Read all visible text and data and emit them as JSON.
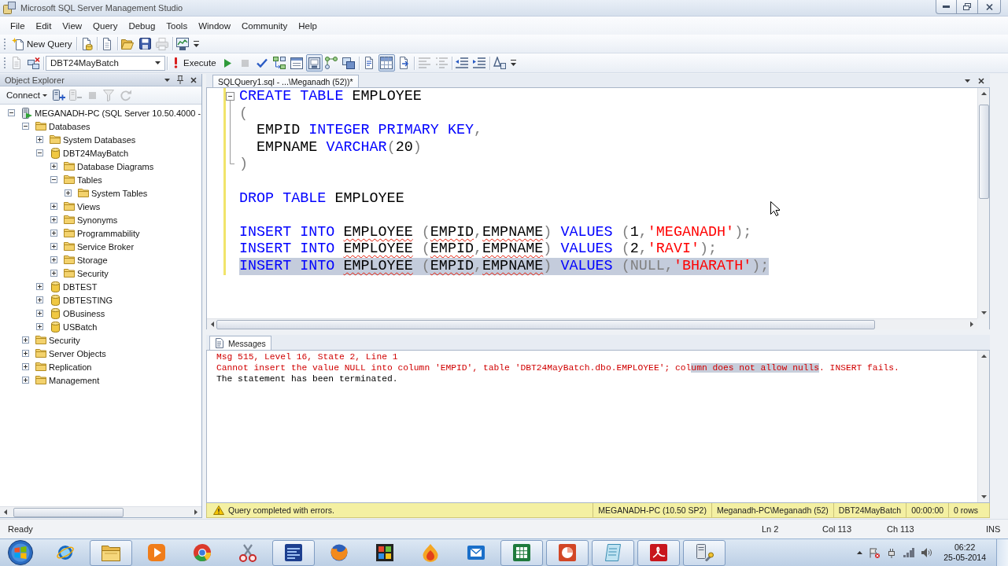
{
  "window": {
    "title": "Microsoft SQL Server Management Studio"
  },
  "menu": [
    "File",
    "Edit",
    "View",
    "Query",
    "Debug",
    "Tools",
    "Window",
    "Community",
    "Help"
  ],
  "standard_toolbar": {
    "new_query": "New Query",
    "button_groups": [
      [
        {
          "disabled": false
        }
      ],
      [
        {
          "disabled": false
        }
      ],
      [
        {
          "disabled": false
        },
        {
          "disabled": false
        },
        {
          "disabled": true
        }
      ],
      [
        {
          "disabled": false
        }
      ]
    ]
  },
  "query_toolbar": {
    "leading": [
      {
        "disabled": true
      },
      {
        "disabled": false
      }
    ],
    "database": "DBT24MayBatch",
    "execute": "Execute",
    "button_groups": [
      [
        {
          "disabled": false,
          "pressed": false
        },
        {
          "disabled": true,
          "pressed": false
        },
        {
          "disabled": false,
          "pressed": false
        },
        {
          "disabled": false,
          "pressed": false
        },
        {
          "disabled": false,
          "pressed": false
        },
        {
          "disabled": false,
          "pressed": true
        },
        {
          "disabled": false,
          "pressed": false
        },
        {
          "disabled": false,
          "pressed": false
        }
      ],
      [
        {
          "disabled": false,
          "pressed": false
        },
        {
          "disabled": false,
          "pressed": true
        },
        {
          "disabled": false,
          "pressed": false
        }
      ],
      [
        {
          "disabled": true,
          "pressed": false
        },
        {
          "disabled": true,
          "pressed": false
        }
      ],
      [
        {
          "disabled": false,
          "pressed": false
        },
        {
          "disabled": false,
          "pressed": false
        }
      ],
      [
        {
          "disabled": false,
          "pressed": false
        }
      ]
    ]
  },
  "object_explorer": {
    "title": "Object Explorer",
    "connect": "Connect",
    "tools": [
      {
        "disabled": false
      },
      {
        "disabled": true
      },
      {
        "disabled": true
      },
      {
        "disabled": true
      },
      {
        "disabled": true
      }
    ],
    "tree": [
      {
        "label": "MEGANADH-PC (SQL Server 10.50.4000 -",
        "kind": "server",
        "expanded": true,
        "children": [
          {
            "label": "Databases",
            "kind": "folder",
            "expanded": true,
            "children": [
              {
                "label": "System Databases",
                "kind": "folder",
                "expanded": false
              },
              {
                "label": "DBT24MayBatch",
                "kind": "database",
                "expanded": true,
                "children": [
                  {
                    "label": "Database Diagrams",
                    "kind": "folder",
                    "expanded": false
                  },
                  {
                    "label": "Tables",
                    "kind": "folder",
                    "expanded": true,
                    "children": [
                      {
                        "label": "System Tables",
                        "kind": "folder",
                        "expanded": false
                      }
                    ]
                  },
                  {
                    "label": "Views",
                    "kind": "folder",
                    "expanded": false
                  },
                  {
                    "label": "Synonyms",
                    "kind": "folder",
                    "expanded": false
                  },
                  {
                    "label": "Programmability",
                    "kind": "folder",
                    "expanded": false
                  },
                  {
                    "label": "Service Broker",
                    "kind": "folder",
                    "expanded": false
                  },
                  {
                    "label": "Storage",
                    "kind": "folder",
                    "expanded": false
                  },
                  {
                    "label": "Security",
                    "kind": "folder",
                    "expanded": false
                  }
                ]
              },
              {
                "label": "DBTEST",
                "kind": "database",
                "expanded": false
              },
              {
                "label": "DBTESTING",
                "kind": "database",
                "expanded": false
              },
              {
                "label": "OBusiness",
                "kind": "database",
                "expanded": false
              },
              {
                "label": "USBatch",
                "kind": "database",
                "expanded": false
              }
            ]
          },
          {
            "label": "Security",
            "kind": "folder",
            "expanded": false
          },
          {
            "label": "Server Objects",
            "kind": "folder",
            "expanded": false
          },
          {
            "label": "Replication",
            "kind": "folder",
            "expanded": false
          },
          {
            "label": "Management",
            "kind": "folder",
            "expanded": false
          }
        ]
      }
    ]
  },
  "editor": {
    "tabs": [
      {
        "label": "SQLQuery1.sql - ...\\Meganadh (52))*",
        "selected": true
      }
    ],
    "blocks": [
      {
        "outlined": true,
        "lines": [
          {
            "selected": false,
            "tokens": [
              {
                "text": "CREATE TABLE ",
                "kind": "keyword"
              },
              {
                "text": "EMPLOYEE",
                "kind": "identifier"
              }
            ]
          },
          {
            "selected": false,
            "tokens": [
              {
                "text": "(",
                "kind": "operator"
              }
            ]
          },
          {
            "selected": false,
            "tokens": [
              {
                "text": "  EMPID ",
                "kind": "identifier"
              },
              {
                "text": "INTEGER PRIMARY KEY",
                "kind": "keyword"
              },
              {
                "text": ",",
                "kind": "operator"
              }
            ]
          },
          {
            "selected": false,
            "tokens": [
              {
                "text": "  EMPNAME ",
                "kind": "identifier"
              },
              {
                "text": "VARCHAR",
                "kind": "keyword"
              },
              {
                "text": "(",
                "kind": "operator"
              },
              {
                "text": "20",
                "kind": "number"
              },
              {
                "text": ")",
                "kind": "operator"
              }
            ]
          },
          {
            "selected": false,
            "tokens": [
              {
                "text": ")",
                "kind": "operator"
              }
            ]
          }
        ]
      },
      {
        "outlined": false,
        "lines": [
          {
            "selected": false,
            "tokens": [
              {
                "text": "DROP TABLE ",
                "kind": "keyword"
              },
              {
                "text": "EMPLOYEE",
                "kind": "identifier"
              }
            ]
          }
        ]
      },
      {
        "outlined": false,
        "lines": [
          {
            "selected": false,
            "tokens": [
              {
                "text": "INSERT INTO ",
                "kind": "keyword"
              },
              {
                "text": "EMPLOYEE",
                "kind": "unresolved"
              },
              {
                "text": " (",
                "kind": "operator"
              },
              {
                "text": "EMPID",
                "kind": "unresolved"
              },
              {
                "text": ",",
                "kind": "operator"
              },
              {
                "text": "EMPNAME",
                "kind": "unresolved"
              },
              {
                "text": ") ",
                "kind": "operator"
              },
              {
                "text": "VALUES ",
                "kind": "keyword"
              },
              {
                "text": "(",
                "kind": "operator"
              },
              {
                "text": "1",
                "kind": "number"
              },
              {
                "text": ",",
                "kind": "operator"
              },
              {
                "text": "'MEGANADH'",
                "kind": "string"
              },
              {
                "text": ");",
                "kind": "operator"
              }
            ]
          },
          {
            "selected": false,
            "tokens": [
              {
                "text": "INSERT INTO ",
                "kind": "keyword"
              },
              {
                "text": "EMPLOYEE",
                "kind": "unresolved"
              },
              {
                "text": " (",
                "kind": "operator"
              },
              {
                "text": "EMPID",
                "kind": "unresolved"
              },
              {
                "text": ",",
                "kind": "operator"
              },
              {
                "text": "EMPNAME",
                "kind": "unresolved"
              },
              {
                "text": ") ",
                "kind": "operator"
              },
              {
                "text": "VALUES ",
                "kind": "keyword"
              },
              {
                "text": "(",
                "kind": "operator"
              },
              {
                "text": "2",
                "kind": "number"
              },
              {
                "text": ",",
                "kind": "operator"
              },
              {
                "text": "'RAVI'",
                "kind": "string"
              },
              {
                "text": ");",
                "kind": "operator"
              }
            ]
          },
          {
            "selected": true,
            "tokens": [
              {
                "text": "INSERT INTO ",
                "kind": "keyword"
              },
              {
                "text": "EMPLOYEE",
                "kind": "unresolved"
              },
              {
                "text": " (",
                "kind": "operator"
              },
              {
                "text": "EMPID",
                "kind": "unresolved"
              },
              {
                "text": ",",
                "kind": "operator"
              },
              {
                "text": "EMPNAME",
                "kind": "unresolved"
              },
              {
                "text": ") ",
                "kind": "operator"
              },
              {
                "text": "VALUES ",
                "kind": "keyword"
              },
              {
                "text": "(NULL,",
                "kind": "operator"
              },
              {
                "text": "'BHARATH'",
                "kind": "string"
              },
              {
                "text": ");",
                "kind": "operator"
              }
            ]
          }
        ]
      }
    ]
  },
  "messages": {
    "tabs": [
      {
        "label": "Messages",
        "selected": true
      }
    ],
    "lines": [
      {
        "kind": "error",
        "segments": [
          {
            "text": "Msg 515, Level 16, State 2, Line 1",
            "selected": false
          }
        ]
      },
      {
        "kind": "error",
        "segments": [
          {
            "text": "Cannot insert the value NULL into column 'EMPID', table 'DBT24MayBatch.dbo.EMPLOYEE'; col",
            "selected": false
          },
          {
            "text": "umn does not allow nulls",
            "selected": true
          },
          {
            "text": ". INSERT fails.",
            "selected": false
          }
        ]
      },
      {
        "kind": "info",
        "segments": [
          {
            "text": "The statement has been terminated.",
            "selected": false
          }
        ]
      }
    ]
  },
  "query_status": {
    "message": "Query completed with errors.",
    "fields": [
      "MEGANADH-PC (10.50 SP2)",
      "Meganadh-PC\\Meganadh (52)",
      "DBT24MayBatch",
      "00:00:00",
      "0 rows"
    ]
  },
  "status_bar": {
    "state": "Ready",
    "line": "Ln 2",
    "column": "Col 113",
    "char": "Ch 113",
    "mode": "INS"
  },
  "taskbar": {
    "apps": [
      {
        "running": false
      },
      {
        "running": true
      },
      {
        "running": false
      },
      {
        "running": false
      },
      {
        "running": false
      },
      {
        "running": true
      },
      {
        "running": false
      },
      {
        "running": false
      },
      {
        "running": false
      },
      {
        "running": false
      },
      {
        "running": true
      },
      {
        "running": true
      },
      {
        "running": true
      },
      {
        "running": true
      },
      {
        "running": true
      }
    ],
    "time": "06:22",
    "date": "25-05-2014"
  }
}
